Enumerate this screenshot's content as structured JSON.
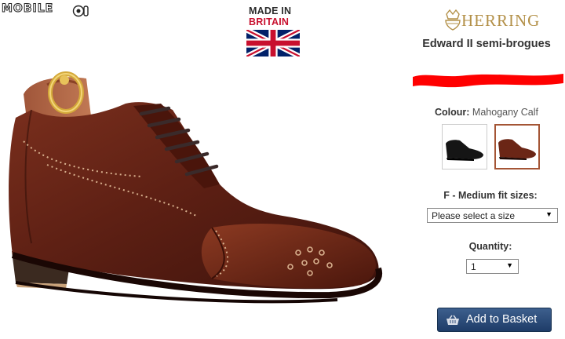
{
  "watermark": {
    "text": "MOBILE"
  },
  "badge": {
    "line1": "MADE IN",
    "line2": "BRITAIN",
    "flag_icon": "union-jack-flag-icon"
  },
  "brand": {
    "name": "HERRING",
    "color": "#b39048"
  },
  "product": {
    "title": "Edward II semi-brogues"
  },
  "colour": {
    "label": "Colour:",
    "value": "Mahogany Calf",
    "swatches": [
      {
        "name": "Black Calf",
        "selected": false
      },
      {
        "name": "Mahogany Calf",
        "selected": true
      }
    ]
  },
  "size": {
    "label": "F - Medium fit sizes:",
    "selected": "Please select a size"
  },
  "quantity": {
    "label": "Quantity:",
    "selected": "1"
  },
  "basket": {
    "label": "Add to Basket",
    "icon": "basket-icon",
    "color": "#2b4a78"
  },
  "price_redaction_color": "#ff0000"
}
